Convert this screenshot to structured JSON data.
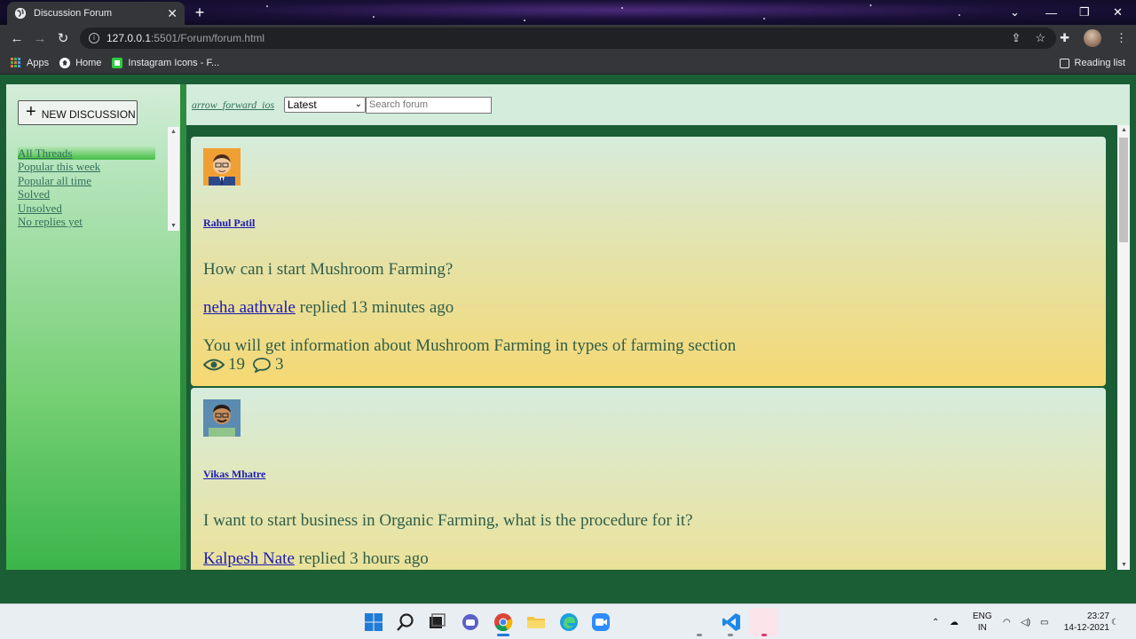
{
  "browser": {
    "tab_title": "Discussion Forum",
    "url_host": "127.0.0.1",
    "url_path": ":5501/Forum/forum.html",
    "bookmarks": [
      "Apps",
      "Home",
      "Instagram Icons - F..."
    ],
    "reading_list": "Reading list"
  },
  "sidebar": {
    "new_discussion": "NEW DISCUSSION",
    "nav": [
      "All Threads",
      "Popular this week",
      "Popular all time",
      "Solved",
      "Unsolved",
      "No replies yet"
    ]
  },
  "toolbar": {
    "arrow_text": "arrow_forward_ios",
    "sort_value": "Latest",
    "search_placeholder": "Search forum"
  },
  "posts": [
    {
      "author": "Rahul Patil",
      "question": "How can i start Mushroom Farming?",
      "replier": "neha aathvale",
      "reply_meta": " replied 13 minutes ago",
      "answer": "You will get information about Mushroom Farming in types of farming section",
      "views": "19",
      "comments": "3"
    },
    {
      "author": "Vikas Mhatre",
      "question": "I want to start business in Organic Farming, what is the procedure for it?",
      "replier": "Kalpesh Nate",
      "reply_meta": " replied 3 hours ago"
    }
  ],
  "taskbar": {
    "lang_top": "ENG",
    "lang_bottom": "IN",
    "time": "23:27",
    "date": "14-12-2021"
  }
}
